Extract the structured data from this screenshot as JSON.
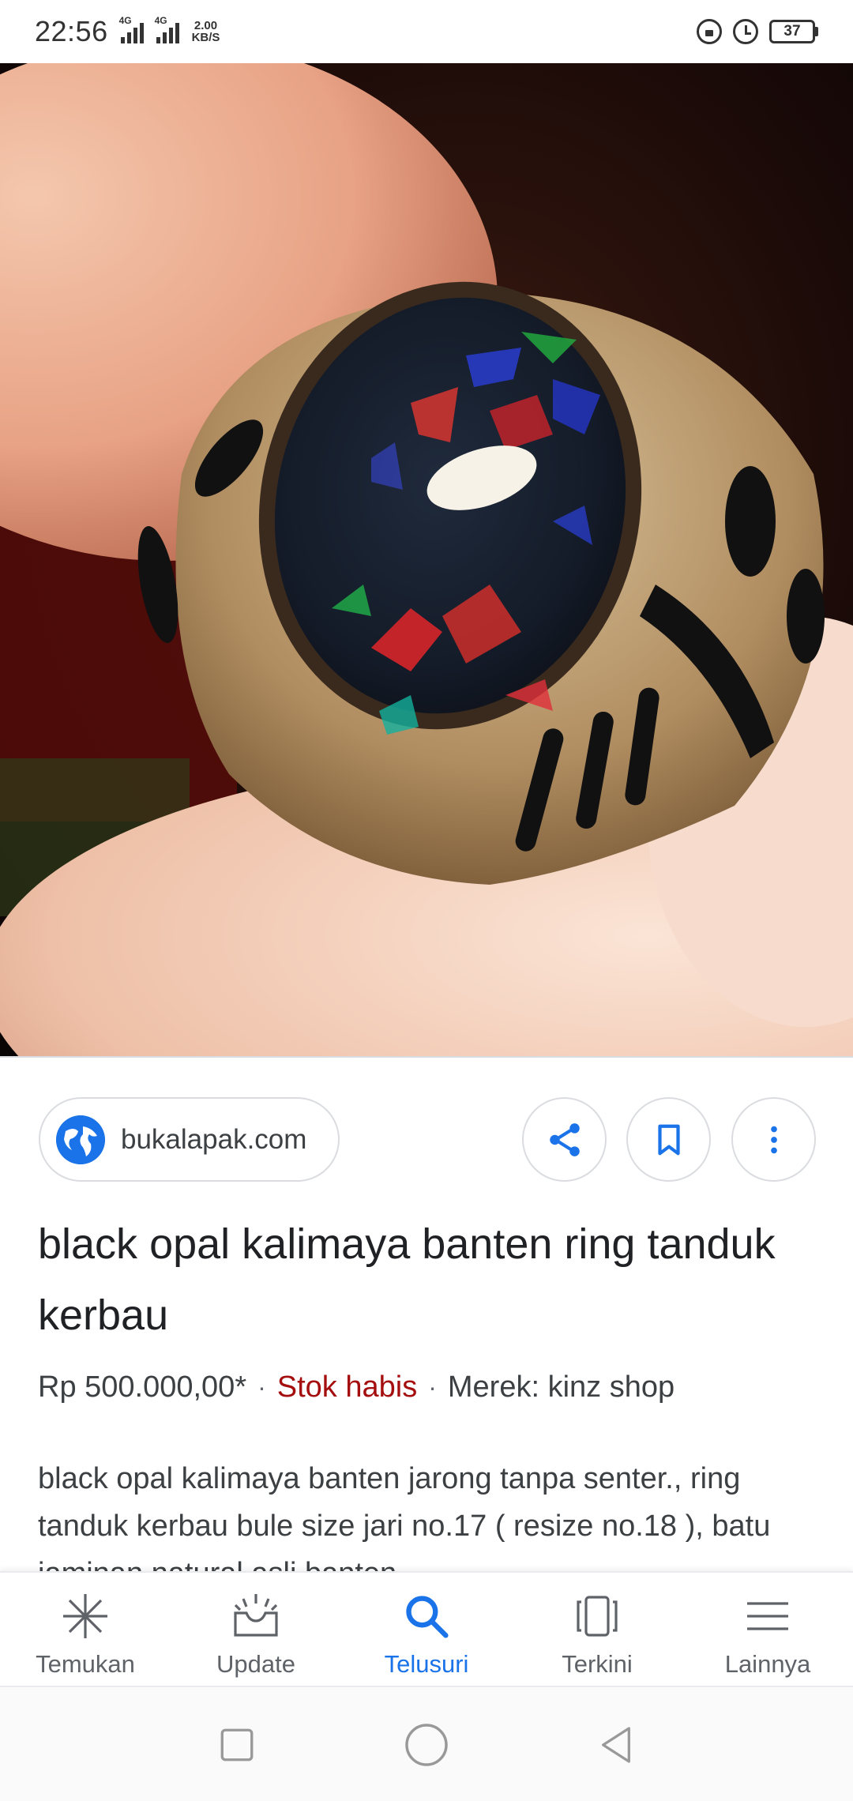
{
  "status_bar": {
    "time": "22:56",
    "network_1": "4G",
    "network_2": "4G",
    "speed_value": "2.00",
    "speed_unit": "KB/S",
    "battery": "37"
  },
  "result": {
    "source": "bukalapak.com",
    "title": "black opal kalimaya banten ring tanduk kerbau",
    "price": "Rp 500.000,00*",
    "separator": "·",
    "stock": "Stok habis",
    "brand": "Merek: kinz shop",
    "description": "black opal kalimaya banten jarong tanpa senter., ring tanduk kerbau bule size jari no.17 ( resize no.18 ), batu jaminan natural asli banten"
  },
  "actions": {
    "share_icon": "share-icon",
    "bookmark_icon": "bookmark-icon",
    "more_icon": "more-vert-icon"
  },
  "bottom_nav": {
    "items": [
      {
        "label": "Temukan",
        "icon": "asterisk-icon"
      },
      {
        "label": "Update",
        "icon": "inbox-icon"
      },
      {
        "label": "Telusuri",
        "icon": "search-icon"
      },
      {
        "label": "Terkini",
        "icon": "recent-cards-icon"
      },
      {
        "label": "Lainnya",
        "icon": "menu-icon"
      }
    ],
    "active_index": 2
  },
  "colors": {
    "accent": "#1a73e8",
    "stock_out": "#a50e0e",
    "text_primary": "#202124",
    "text_secondary": "#3c4043"
  }
}
